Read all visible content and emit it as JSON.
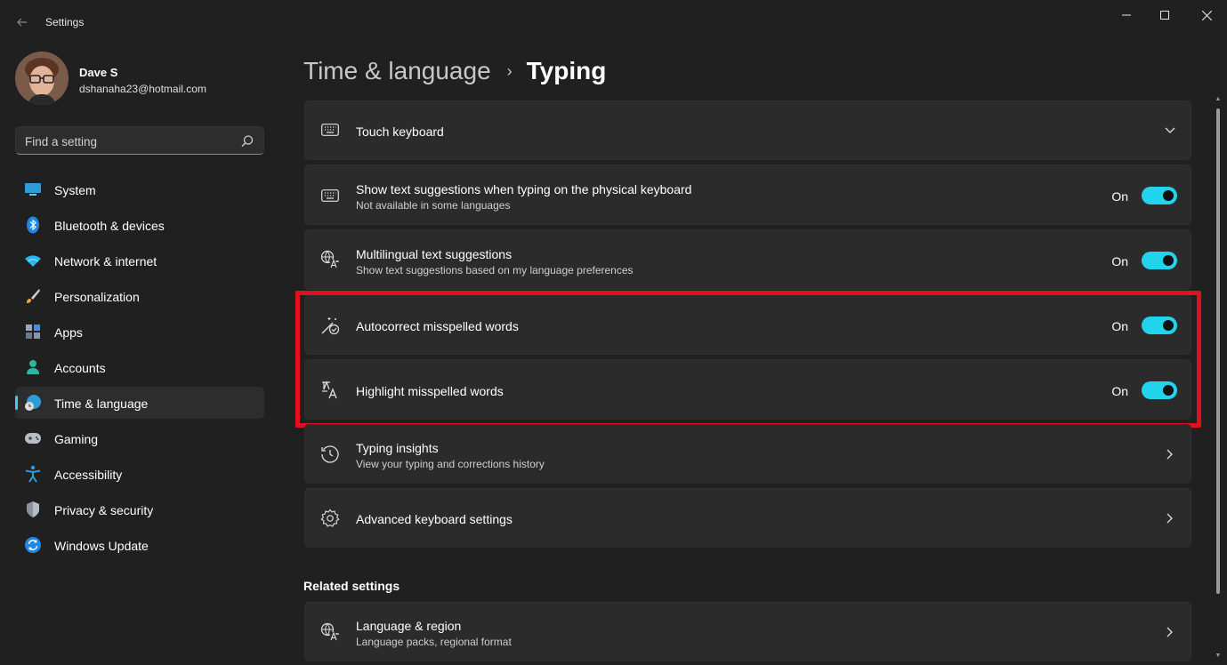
{
  "window": {
    "title": "Settings",
    "back_icon": "back-arrow-icon",
    "controls": [
      "minimize-icon",
      "maximize-icon",
      "close-icon"
    ]
  },
  "profile": {
    "name": "Dave S",
    "email": "dshanaha23@hotmail.com"
  },
  "search": {
    "placeholder": "Find a setting"
  },
  "sidebar": {
    "items": [
      {
        "label": "System",
        "icon": "monitor-icon",
        "active": false
      },
      {
        "label": "Bluetooth & devices",
        "icon": "bluetooth-icon",
        "active": false
      },
      {
        "label": "Network & internet",
        "icon": "wifi-icon",
        "active": false
      },
      {
        "label": "Personalization",
        "icon": "brush-icon",
        "active": false
      },
      {
        "label": "Apps",
        "icon": "apps-icon",
        "active": false
      },
      {
        "label": "Accounts",
        "icon": "person-icon",
        "active": false
      },
      {
        "label": "Time & language",
        "icon": "globe-clock-icon",
        "active": true
      },
      {
        "label": "Gaming",
        "icon": "gamepad-icon",
        "active": false
      },
      {
        "label": "Accessibility",
        "icon": "accessibility-icon",
        "active": false
      },
      {
        "label": "Privacy & security",
        "icon": "shield-icon",
        "active": false
      },
      {
        "label": "Windows Update",
        "icon": "update-icon",
        "active": false
      }
    ]
  },
  "breadcrumb": {
    "parent": "Time & language",
    "separator": "›",
    "current": "Typing"
  },
  "settings": {
    "touch_keyboard": {
      "title": "Touch keyboard",
      "icon": "keyboard-icon"
    },
    "text_suggestions": {
      "title": "Show text suggestions when typing on the physical keyboard",
      "subtitle": "Not available in some languages",
      "state": "On",
      "icon": "keyboard-icon"
    },
    "multilingual": {
      "title": "Multilingual text suggestions",
      "subtitle": "Show text suggestions based on my language preferences",
      "state": "On",
      "icon": "language-icon"
    },
    "autocorrect": {
      "title": "Autocorrect misspelled words",
      "state": "On",
      "icon": "autocorrect-icon"
    },
    "highlight": {
      "title": "Highlight misspelled words",
      "state": "On",
      "icon": "spellcheck-icon"
    },
    "insights": {
      "title": "Typing insights",
      "subtitle": "View your typing and corrections history",
      "icon": "history-icon"
    },
    "advanced": {
      "title": "Advanced keyboard settings",
      "icon": "gear-icon"
    }
  },
  "related": {
    "title": "Related settings",
    "language_region": {
      "title": "Language & region",
      "subtitle": "Language packs, regional format",
      "icon": "language-icon"
    }
  },
  "colors": {
    "background": "#202020",
    "card": "#2b2b2b",
    "accent": "#22d3ee",
    "nav_accent": "#4cc2ff",
    "highlight_border": "#e0101f"
  }
}
